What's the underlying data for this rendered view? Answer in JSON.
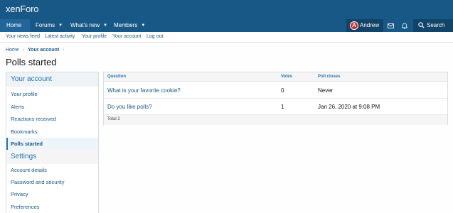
{
  "header": {
    "logo_main": "xen",
    "logo_sub": "Foro"
  },
  "nav": {
    "tabs": [
      {
        "label": "Home",
        "has_menu": false
      },
      {
        "label": "Forums",
        "has_menu": true
      },
      {
        "label": "What's new",
        "has_menu": true
      },
      {
        "label": "Members",
        "has_menu": true
      }
    ],
    "user_name": "Andrew",
    "search_label": "Search"
  },
  "subnav": {
    "links": [
      "Your news feed",
      "Latest activity",
      "Your profile",
      "Your account",
      "Log out"
    ]
  },
  "breadcrumb": {
    "items": [
      "Home",
      "Your account"
    ]
  },
  "page_title": "Polls started",
  "sidebar": {
    "section1_title": "Your account",
    "section1_items": [
      "Your profile",
      "Alerts",
      "Reactions received",
      "Bookmarks",
      "Polls started"
    ],
    "section2_title": "Settings",
    "section2_items": [
      "Account details",
      "Password and security",
      "Privacy",
      "Preferences"
    ]
  },
  "table": {
    "columns": [
      "Question",
      "Votes",
      "Poll closes"
    ],
    "rows": [
      {
        "question": "What is your favorite cookie?",
        "votes": "0",
        "closes": "Never"
      },
      {
        "question": "Do you like polls?",
        "votes": "1",
        "closes": "Jan 26, 2020 at 9:08 PM"
      }
    ],
    "footer": "Total 2"
  },
  "colors": {
    "header_bg": "#185886",
    "link": "#185886",
    "accent": "#2577b1"
  }
}
